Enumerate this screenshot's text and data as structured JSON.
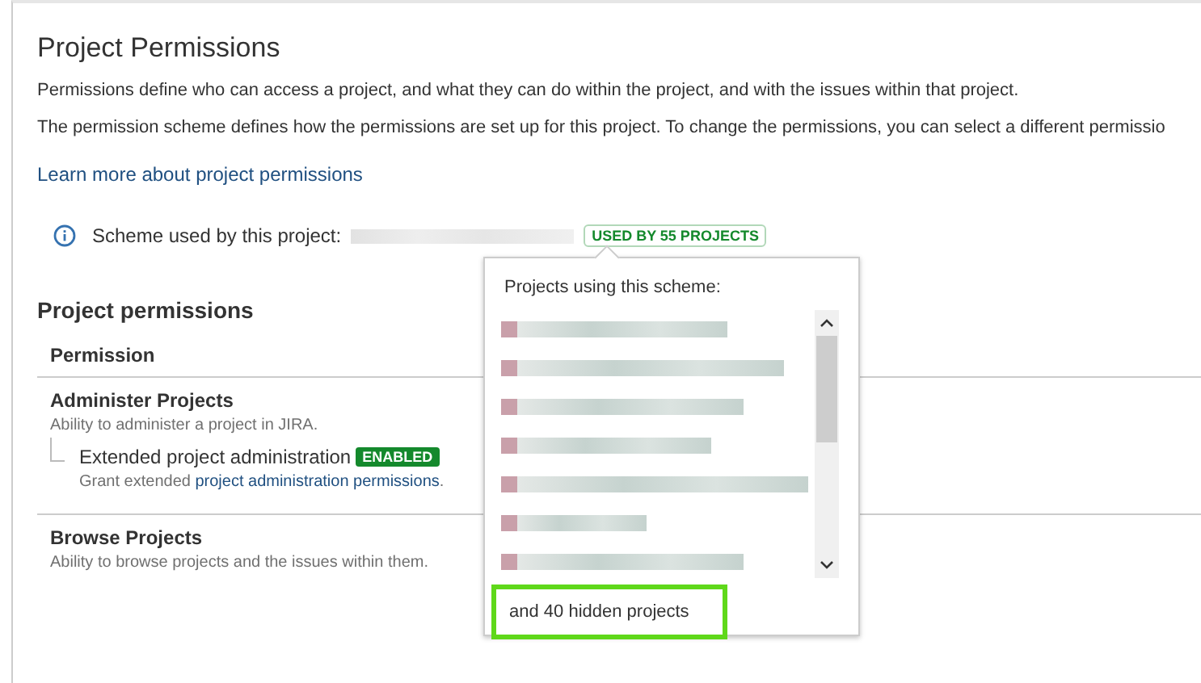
{
  "page": {
    "title": "Project Permissions",
    "paragraphs": [
      "Permissions define who can access a project, and what they can do within the project, and with the issues within that project.",
      "The permission scheme defines how the permissions are set up for this project. To change the permissions, you can select a different permissio"
    ],
    "learn_more_link": "Learn more about project permissions",
    "scheme": {
      "label": "Scheme used by this project:",
      "usage_badge": "USED BY 55 PROJECTS"
    }
  },
  "permissions": {
    "heading": "Project permissions",
    "column": "Permission",
    "rows": [
      {
        "name": "Administer Projects",
        "description": "Ability to administer a project in JIRA.",
        "children": [
          {
            "name": "Extended project administration",
            "badge": "ENABLED",
            "description_prefix": "Grant extended ",
            "description_link": "project administration permissions",
            "description_suffix": "."
          }
        ]
      },
      {
        "name": "Browse Projects",
        "description": "Ability to browse projects and the issues within them."
      }
    ]
  },
  "popup": {
    "title": "Projects using this scheme:",
    "footer": "and 40 hidden projects"
  }
}
